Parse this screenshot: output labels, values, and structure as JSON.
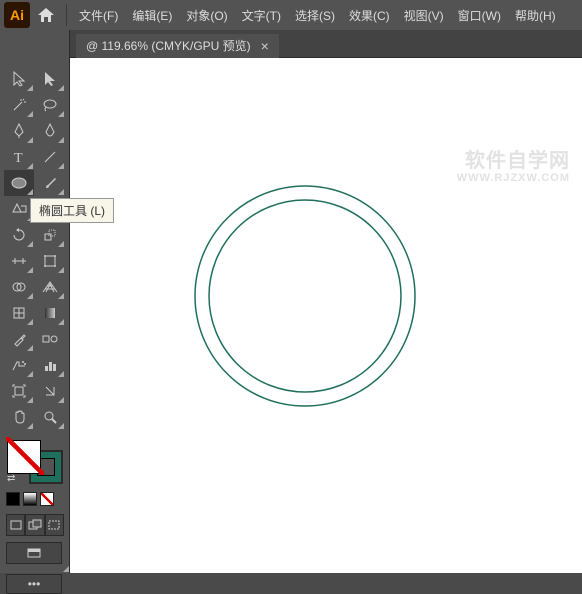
{
  "app": {
    "logo": "Ai"
  },
  "menu": {
    "file": "文件(F)",
    "edit": "编辑(E)",
    "object": "对象(O)",
    "type": "文字(T)",
    "select": "选择(S)",
    "effect": "效果(C)",
    "view": "视图(V)",
    "window": "窗口(W)",
    "help": "帮助(H)"
  },
  "tab": {
    "title": "@ 119.66%  (CMYK/GPU 预览)",
    "close": "×"
  },
  "tooltip": {
    "ellipse": "椭圆工具 (L)"
  },
  "watermark": {
    "line1": "软件自学网",
    "line2": "WWW.RJZXW.COM"
  },
  "colors": {
    "stroke": "#1e6f5c"
  }
}
